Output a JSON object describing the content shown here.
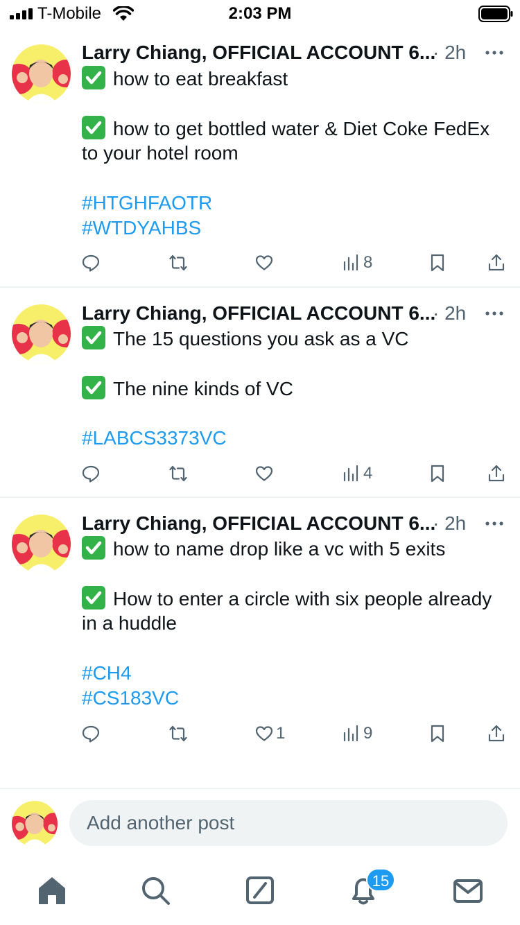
{
  "status_bar": {
    "carrier": "T-Mobile",
    "time": "2:03 PM"
  },
  "posts": [
    {
      "author": "Larry Chiang, OFFICIAL ACCOUNT 6...",
      "time": "· 2h",
      "lines": [
        "how to eat breakfast",
        "how to get bottled water & Diet Coke FedEx",
        "to your hotel room"
      ],
      "hashtags": [
        "#HTGHFAOTR",
        "#WTDYAHBS"
      ],
      "likes": "",
      "views": "8"
    },
    {
      "author": "Larry Chiang, OFFICIAL ACCOUNT 6...",
      "time": "· 2h",
      "lines": [
        "The 15 questions you ask as a VC",
        "The nine kinds of VC"
      ],
      "hashtags": [
        "#LABCS3373VC"
      ],
      "likes": "",
      "views": "4"
    },
    {
      "author": "Larry Chiang, OFFICIAL ACCOUNT 6...",
      "time": "· 2h",
      "lines": [
        "how to name drop like a vc with 5 exits",
        "How to enter a circle with six people already",
        "in a huddle"
      ],
      "hashtags": [
        "#CH4",
        "#CS183VC"
      ],
      "likes": "1",
      "views": "9"
    }
  ],
  "reply": {
    "placeholder": "Add another post"
  },
  "tabs": {
    "notifications_badge": "15"
  },
  "icons": {
    "check": "white-heavy-check-mark-emoji",
    "reply": "speech-bubble-icon",
    "repost": "repost-arrows-icon",
    "like": "heart-icon",
    "views": "bar-chart-icon",
    "bookmark": "bookmark-icon",
    "share": "share-icon"
  },
  "colors": {
    "accent": "#1d9bf0",
    "secondary_text": "#536471",
    "check_green": "#33b24a"
  }
}
